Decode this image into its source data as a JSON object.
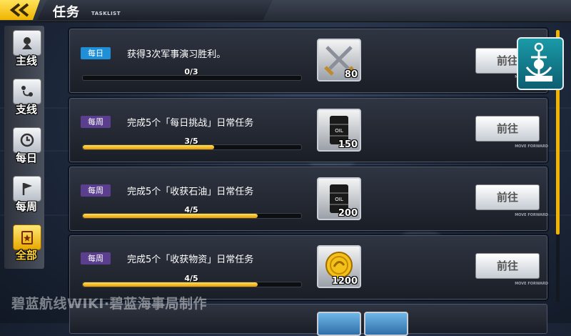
{
  "header": {
    "back_icon": "double-chevron-left-icon",
    "title": "任务",
    "subtitle": "TASKLIST"
  },
  "sidebar": {
    "items": [
      {
        "icon": "map-pin-icon",
        "label": "主线",
        "active": false
      },
      {
        "icon": "route-pins-icon",
        "label": "支线",
        "active": false
      },
      {
        "icon": "clock-history-icon",
        "label": "每日",
        "active": false
      },
      {
        "icon": "flag-icon",
        "label": "每周",
        "active": false
      },
      {
        "icon": "clipboard-star-icon",
        "label": "全部",
        "active": true
      }
    ]
  },
  "tasks": [
    {
      "type": "每日",
      "text": "获得3次军事演习胜利。",
      "progress_text": "0/3",
      "progress": 0.0,
      "reward_icon": "crossed-swords-icon",
      "reward_qty": "80",
      "button": "前往",
      "button_sub": "MOVE FORWARD"
    },
    {
      "type": "每周",
      "text": "完成5个「每日挑战」日常任务",
      "progress_text": "3/5",
      "progress": 0.6,
      "reward_icon": "oil-barrel-icon",
      "reward_qty": "150",
      "button": "前往",
      "button_sub": "MOVE FORWARD"
    },
    {
      "type": "每周",
      "text": "完成5个「收获石油」日常任务",
      "progress_text": "4/5",
      "progress": 0.8,
      "reward_icon": "oil-barrel-icon",
      "reward_qty": "200",
      "button": "前往",
      "button_sub": "MOVE FORWARD"
    },
    {
      "type": "每周",
      "text": "完成5个「收获物资」日常任务",
      "progress_text": "4/5",
      "progress": 0.8,
      "reward_icon": "gold-coin-icon",
      "reward_qty": "1200",
      "button": "前往",
      "button_sub": "MOVE FORWARD"
    }
  ],
  "scroll": {
    "position": 0.0
  },
  "watermark": "碧蓝航线WIKI·碧蓝海事局制作",
  "colors": {
    "accent": "#f2b200",
    "daily_badge": "#1f8fd8",
    "weekly_badge": "#5b3f8e"
  }
}
